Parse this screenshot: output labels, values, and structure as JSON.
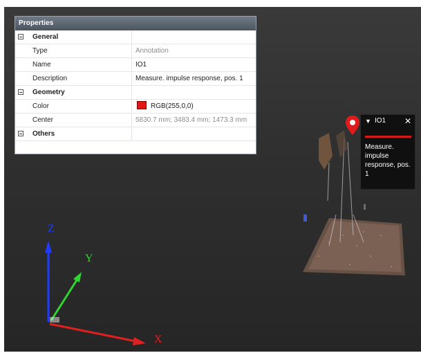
{
  "properties_panel": {
    "title": "Properties",
    "categories": [
      {
        "name": "General",
        "rows": [
          {
            "label": "Type",
            "value": "Annotation",
            "readonly": true
          },
          {
            "label": "Name",
            "value": "IO1"
          },
          {
            "label": "Description",
            "value": "Measure. impulse response, pos. 1"
          }
        ]
      },
      {
        "name": "Geometry",
        "rows": [
          {
            "label": "Color",
            "value": "RGB(255,0,0)",
            "swatch": "#e31414"
          },
          {
            "label": "Center",
            "value": "5830.7 mm; 3483.4 mm; 1473.3 mm",
            "readonly": true
          }
        ]
      },
      {
        "name": "Others",
        "rows": []
      }
    ]
  },
  "annotation": {
    "title": "IO1",
    "text": "Measure. impulse response, pos. 1",
    "accent_color": "#d61919"
  },
  "axes": {
    "x_label": "X",
    "y_label": "Y",
    "z_label": "Z",
    "x_color": "#e02020",
    "y_color": "#2fd62f",
    "z_color": "#1f3bff"
  },
  "icons": {
    "pin": "map-pin-icon",
    "close": "close-icon",
    "collapse": "collapse-triangle-icon"
  }
}
